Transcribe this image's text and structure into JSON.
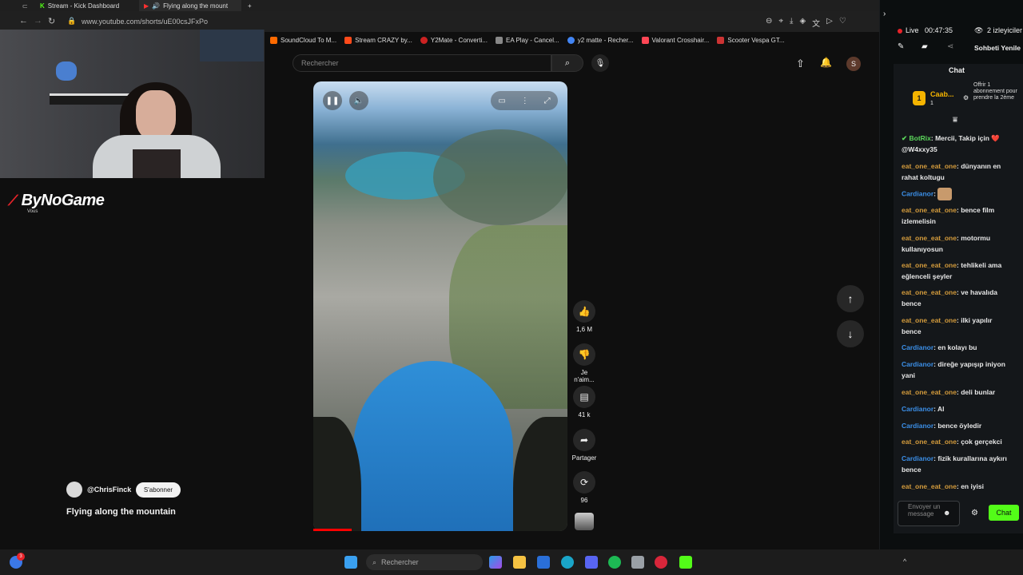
{
  "browser": {
    "tabs": [
      {
        "label": "Stream - Kick Dashboard"
      },
      {
        "label": "Flying along the mount"
      }
    ],
    "url": "www.youtube.com/shorts/uE00csJFxPo",
    "bookmarks": [
      {
        "label": "SoundCloud To M...",
        "color": "#ff6a00"
      },
      {
        "label": "Stream CRAZY by...",
        "color": "#ff4a1a"
      },
      {
        "label": "Y2Mate - Converti...",
        "color": "#cc2222"
      },
      {
        "label": "EA Play - Cancel...",
        "color": "#888888"
      },
      {
        "label": "y2 matte - Recher...",
        "color": "#4285f4"
      },
      {
        "label": "Valorant Crosshair...",
        "color": "#ff4655"
      },
      {
        "label": "Scooter Vespa GT...",
        "color": "#cc3333"
      }
    ]
  },
  "overlay": {
    "brand": "ByNoGame",
    "brand_sub": "Vous"
  },
  "youtube": {
    "search_placeholder": "Rechercher",
    "avatar_letter": "S",
    "channel": "@ChrisFinck",
    "subscribe_label": "S'abonner",
    "video_title": "Flying along the mountain",
    "actions": {
      "likes": "1,6 M",
      "dislike_label": "Je n'aim...",
      "comments": "41 k",
      "share_label": "Partager",
      "remix_count": "96"
    }
  },
  "chat": {
    "live_label": "Live",
    "live_time": "00:47:35",
    "viewers": "2 izleyiciler",
    "refresh_label": "Sohbeti Yenile",
    "title": "Chat",
    "pinned_user": "Caab...",
    "pinned_count": "1",
    "pinned_rank": "1",
    "gift_text": "Offrir 1 abonnement pour prendre la 2ème",
    "messages": [
      {
        "user": "BotRix",
        "text": "Mercii, Takip için ❤️@W4xxy35",
        "type": "bot"
      },
      {
        "user": "eat_one_eat_one",
        "text": "dünyanın en rahat koltugu",
        "type": "eat"
      },
      {
        "user": "Cardianor",
        "text": "",
        "type": "card",
        "emote": true
      },
      {
        "user": "eat_one_eat_one",
        "text": "bence film izlemelisin",
        "type": "eat"
      },
      {
        "user": "eat_one_eat_one",
        "text": "motormu kullanıyosun",
        "type": "eat"
      },
      {
        "user": "eat_one_eat_one",
        "text": "tehlikeli ama eğlenceli şeyler",
        "type": "eat"
      },
      {
        "user": "eat_one_eat_one",
        "text": "ve havalıda bence",
        "type": "eat"
      },
      {
        "user": "eat_one_eat_one",
        "text": "ilki yapılır bence",
        "type": "eat"
      },
      {
        "user": "Cardianor",
        "text": "en kolayı bu",
        "type": "card"
      },
      {
        "user": "Cardianor",
        "text": "direğe yapışıp iniyon yani",
        "type": "card"
      },
      {
        "user": "eat_one_eat_one",
        "text": "deli bunlar",
        "type": "eat"
      },
      {
        "user": "Cardianor",
        "text": "Al",
        "type": "card"
      },
      {
        "user": "Cardianor",
        "text": "bence öyledir",
        "type": "card"
      },
      {
        "user": "eat_one_eat_one",
        "text": "çok gerçekci",
        "type": "eat"
      },
      {
        "user": "Cardianor",
        "text": "fizik kurallarına aykırı bence",
        "type": "card"
      },
      {
        "user": "eat_one_eat_one",
        "text": "en iyisi",
        "type": "eat"
      }
    ],
    "input_placeholder": "Envoyer un message",
    "send_label": "Chat"
  },
  "taskbar": {
    "search_placeholder": "Rechercher",
    "notif_count": "3"
  },
  "colors": {
    "kick_green": "#53fc18",
    "yt_red": "#ff0000",
    "chat_user_eat": "#d39b3c",
    "chat_user_card": "#3b8fe8"
  }
}
